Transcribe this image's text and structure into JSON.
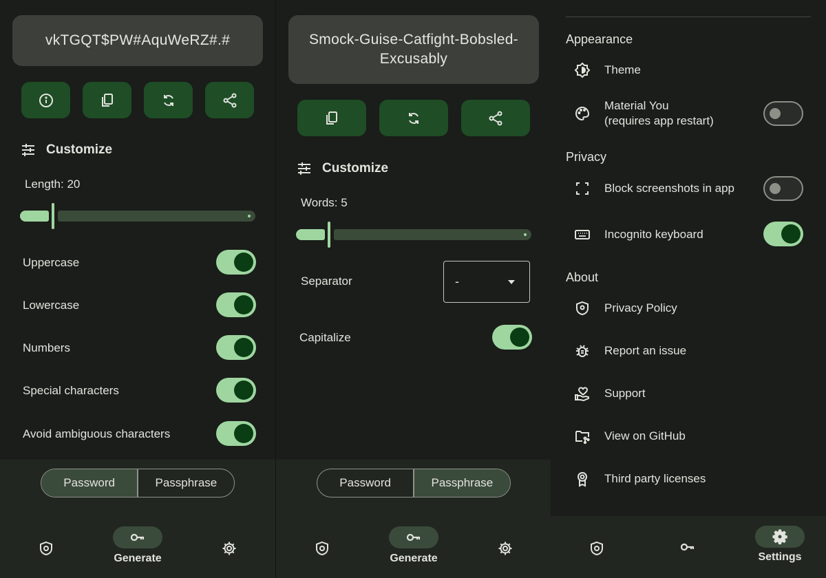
{
  "password_panel": {
    "password": "vkTGQT$PW#AquWeRZ#.#",
    "actions": [
      "info",
      "copy",
      "regenerate",
      "share"
    ],
    "customize_label": "Customize",
    "length_label": "Length: 20",
    "length_value": 20,
    "options": [
      {
        "label": "Uppercase",
        "on": true
      },
      {
        "label": "Lowercase",
        "on": true
      },
      {
        "label": "Numbers",
        "on": true
      },
      {
        "label": "Special characters",
        "on": true
      },
      {
        "label": "Avoid ambiguous characters",
        "on": true
      }
    ],
    "mode_password": "Password",
    "mode_passphrase": "Passphrase",
    "selected_mode": "Password"
  },
  "passphrase_panel": {
    "passphrase": "Smock-Guise-Catfight-Bobsled-Excusably",
    "customize_label": "Customize",
    "words_label": "Words: 5",
    "words_value": 5,
    "separator_label": "Separator",
    "separator_value": "-",
    "capitalize_label": "Capitalize",
    "capitalize_on": true,
    "mode_password": "Password",
    "mode_passphrase": "Passphrase",
    "selected_mode": "Passphrase"
  },
  "settings_panel": {
    "sections": {
      "appearance": "Appearance",
      "privacy": "Privacy",
      "about": "About"
    },
    "theme": "Theme",
    "material_you": "Material You",
    "material_you_sub": "(requires app restart)",
    "material_you_on": false,
    "block_screenshots": "Block screenshots in app",
    "block_screenshots_on": false,
    "incognito_keyboard": "Incognito keyboard",
    "incognito_keyboard_on": true,
    "privacy_policy": "Privacy Policy",
    "report_issue": "Report an issue",
    "support": "Support",
    "view_github": "View on GitHub",
    "third_party": "Third party licenses"
  },
  "nav": {
    "generate_label": "Generate",
    "settings_label": "Settings"
  },
  "colors": {
    "background": "#1a1d19",
    "accent": "#9fd6a0",
    "button": "#1e4d26",
    "pill": "#3b4b3b"
  }
}
